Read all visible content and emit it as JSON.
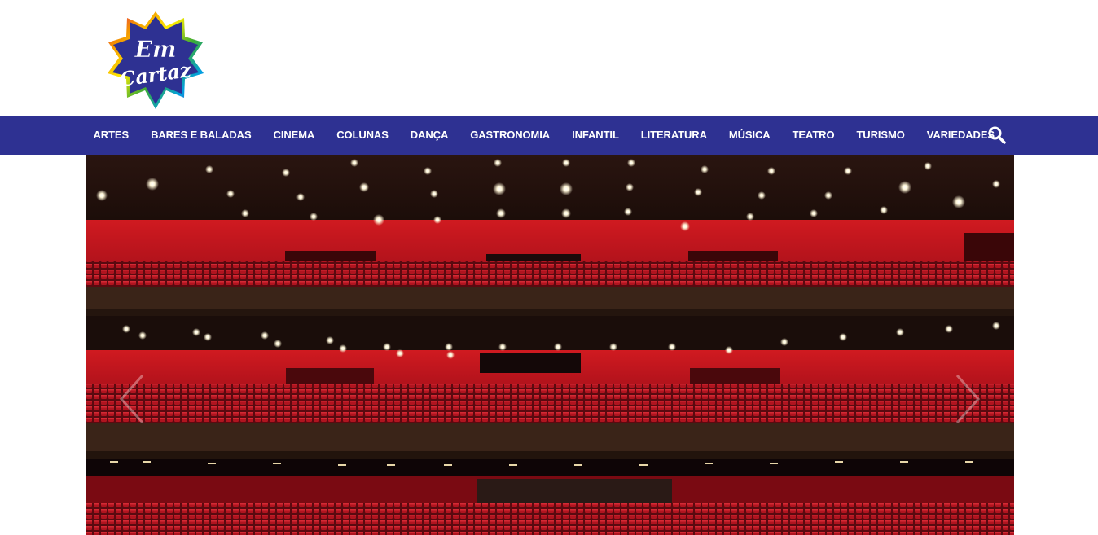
{
  "logo": {
    "text_line1": "Em",
    "text_line2": "Cartaz"
  },
  "nav": {
    "items": [
      {
        "label": "ARTES"
      },
      {
        "label": "BARES E BALADAS"
      },
      {
        "label": "CINEMA"
      },
      {
        "label": "COLUNAS"
      },
      {
        "label": "DANÇA"
      },
      {
        "label": "GASTRONOMIA"
      },
      {
        "label": "INFANTIL"
      },
      {
        "label": "LITERATURA"
      },
      {
        "label": "MÚSICA"
      },
      {
        "label": "TEATRO"
      },
      {
        "label": "TURISMO"
      },
      {
        "label": "VARIEDADES"
      }
    ],
    "search_icon": "search-icon"
  },
  "hero": {
    "image": "theater-auditorium-red-seats",
    "prev_icon": "chevron-left-icon",
    "next_icon": "chevron-right-icon"
  },
  "colors": {
    "nav_bg": "#2e3192",
    "nav_text": "#ffffff",
    "theater_red": "#c4141a",
    "logo_blue": "#2e3192"
  }
}
